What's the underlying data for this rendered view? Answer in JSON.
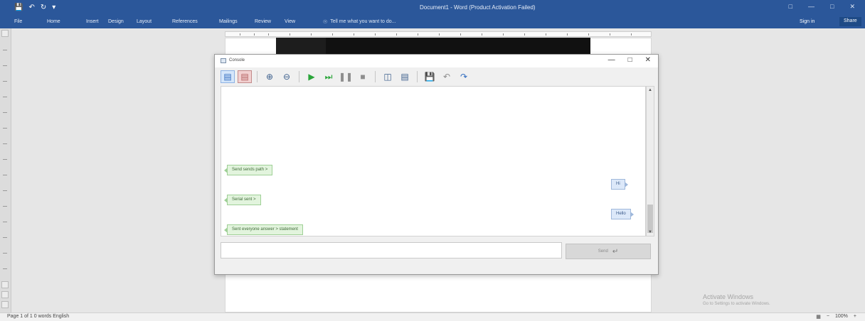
{
  "word": {
    "title": "Document1 - Word (Product Activation Failed)",
    "qat_icons": [
      "save-icon",
      "undo-icon",
      "redo-icon",
      "customize-icon"
    ],
    "menu_tabs": [
      "File",
      "Home",
      "Insert",
      "Design",
      "Layout",
      "References",
      "Mailings",
      "Review",
      "View"
    ],
    "tell_me": "Tell me what you want to do...",
    "sign_in": "Sign in",
    "share": "Share",
    "status_left": "Page 1 of 1   0 words   English",
    "zoom": "100%",
    "activate_title": "Activate Windows",
    "activate_sub": "Go to Settings to activate Windows."
  },
  "console": {
    "title": "Console",
    "toolbar_icons": [
      "view-left-icon",
      "view-right-icon",
      "zoom-in-icon",
      "zoom-out-icon",
      "run-icon",
      "step-icon",
      "pause-icon",
      "stop-icon",
      "window-icon",
      "window2-icon",
      "save-icon",
      "undo-icon",
      "redo-icon"
    ],
    "messages": [
      {
        "side": "left",
        "text": "Send sends path >"
      },
      {
        "side": "right",
        "text": "Hi"
      },
      {
        "side": "left",
        "text": "Serial sent >"
      },
      {
        "side": "right",
        "text": "Hello"
      },
      {
        "side": "left",
        "text": "Sent everyone answer > statement"
      }
    ],
    "input_value": "",
    "send_label": "Send"
  }
}
